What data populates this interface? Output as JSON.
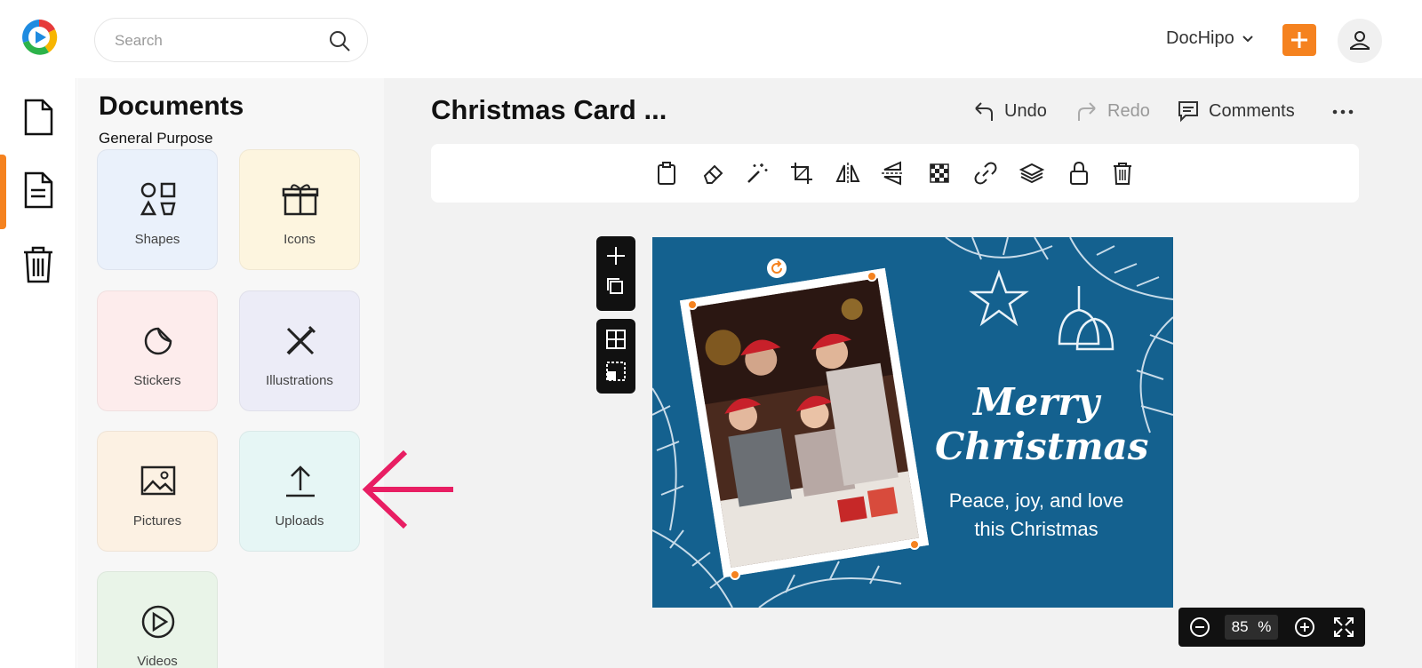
{
  "header": {
    "search_placeholder": "Search",
    "brand": "DocHipo",
    "accent_color": "#f5821f"
  },
  "panel": {
    "title": "Documents",
    "subtitle": "General Purpose",
    "tiles": [
      {
        "label": "Shapes",
        "icon": "shapes-icon"
      },
      {
        "label": "Icons",
        "icon": "gift-icon"
      },
      {
        "label": "Stickers",
        "icon": "sticker-icon"
      },
      {
        "label": "Illustrations",
        "icon": "illustration-icon"
      },
      {
        "label": "Pictures",
        "icon": "image-icon"
      },
      {
        "label": "Uploads",
        "icon": "upload-icon"
      },
      {
        "label": "Videos",
        "icon": "play-icon"
      }
    ]
  },
  "editor": {
    "title": "Christmas Card ...",
    "undo": "Undo",
    "redo": "Redo",
    "comments": "Comments"
  },
  "card": {
    "headline_line1": "Merry",
    "headline_line2": "Christmas",
    "message_line1": "Peace, joy, and love",
    "message_line2": "this Christmas",
    "background_color": "#14618f"
  },
  "zoom": {
    "value": "85",
    "unit": "%"
  }
}
